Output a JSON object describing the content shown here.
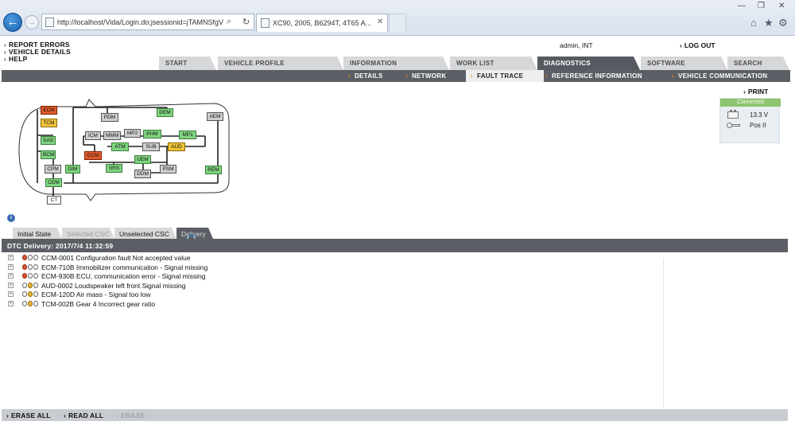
{
  "browser": {
    "address": "http://localhost/Vida/Login.do;jsessionid=jTAMNSfgV",
    "tab_title": "XC90, 2005, B6294T, 4T65 A...",
    "window_controls": [
      "—",
      "❐",
      "✕"
    ],
    "tools": [
      "⌂",
      "★",
      "⚙"
    ]
  },
  "header": {
    "links": [
      "REPORT ERRORS",
      "VEHICLE DETAILS",
      "HELP"
    ],
    "user": "admin, INT",
    "logout": "LOG OUT"
  },
  "main_tabs": [
    {
      "label": "START",
      "active": false
    },
    {
      "label": "VEHICLE PROFILE",
      "active": false
    },
    {
      "label": "INFORMATION",
      "active": false
    },
    {
      "label": "WORK LIST",
      "active": false
    },
    {
      "label": "DIAGNOSTICS",
      "active": true
    },
    {
      "label": "SOFTWARE",
      "active": false
    },
    {
      "label": "SEARCH",
      "active": false
    }
  ],
  "sub_tabs": [
    {
      "label": "DETAILS",
      "active": false
    },
    {
      "label": "NETWORK",
      "active": false
    },
    {
      "label": "FAULT TRACE",
      "active": true
    },
    {
      "label": "REFERENCE INFORMATION",
      "active": false
    },
    {
      "label": "VEHICLE COMMUNICATION",
      "active": false
    }
  ],
  "network": {
    "nodes": [
      {
        "label": "ECM",
        "status": "error"
      },
      {
        "label": "TCM",
        "status": "warn"
      },
      {
        "label": "PDM",
        "status": "neutral"
      },
      {
        "label": "DEM",
        "status": "ok"
      },
      {
        "label": "AEM",
        "status": "neutral"
      },
      {
        "label": "SAS",
        "status": "ok"
      },
      {
        "label": "BCM",
        "status": "ok"
      },
      {
        "label": "ICM",
        "status": "neutral"
      },
      {
        "label": "MMM",
        "status": "neutral"
      },
      {
        "label": "MP2",
        "status": "neutral"
      },
      {
        "label": "PHM",
        "status": "ok"
      },
      {
        "label": "MP1",
        "status": "ok"
      },
      {
        "label": "ATM",
        "status": "ok"
      },
      {
        "label": "SUB",
        "status": "neutral"
      },
      {
        "label": "AUD",
        "status": "warn"
      },
      {
        "label": "CCM",
        "status": "error"
      },
      {
        "label": "UEM",
        "status": "ok"
      },
      {
        "label": "SRS",
        "status": "ok"
      },
      {
        "label": "DDM",
        "status": "neutral"
      },
      {
        "label": "PSM",
        "status": "neutral"
      },
      {
        "label": "REM",
        "status": "ok"
      },
      {
        "label": "CPM",
        "status": "neutral"
      },
      {
        "label": "DIM",
        "status": "ok"
      },
      {
        "label": "CEM",
        "status": "ok"
      },
      {
        "label": "CT",
        "status": "empty"
      }
    ]
  },
  "status_panel": {
    "print": "PRINT",
    "connection": "Connected",
    "voltage": "13.3 V",
    "ignition": "Pos II"
  },
  "result_tabs": [
    {
      "label": "Initial State",
      "state": "normal"
    },
    {
      "label": "Selected CSC",
      "state": "disabled"
    },
    {
      "label": "Unselected CSC",
      "state": "normal"
    },
    {
      "label": "Delivery",
      "state": "active"
    }
  ],
  "dtc_header": "DTC Delivery: 2017/7/4 11:32:59",
  "dtcs": [
    {
      "code": "CCM-0001 Configuration fault Not accepted value",
      "indicator": "red"
    },
    {
      "code": "ECM-710B Immobilizer communication - Signal missing",
      "indicator": "red"
    },
    {
      "code": "ECM-930B ECU, communication error - Signal missing",
      "indicator": "red"
    },
    {
      "code": "AUD-0002 Loudspeaker left front Signal missing",
      "indicator": "amber"
    },
    {
      "code": "ECM-120D Air mass - Signal too low",
      "indicator": "amber"
    },
    {
      "code": "TCM-002B Gear 4 Incorrect gear ratio",
      "indicator": "amber"
    }
  ],
  "bottom_bar": {
    "erase_all": "ERASE ALL",
    "read_all": "READ ALL",
    "erase": "ERASE"
  }
}
